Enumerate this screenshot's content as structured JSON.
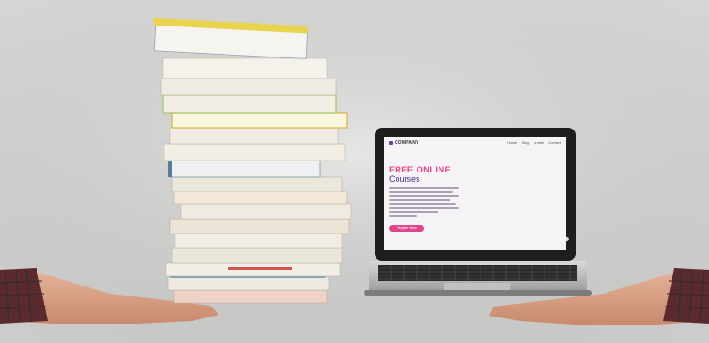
{
  "image": {
    "description_free": true
  },
  "laptop_site": {
    "brand": "COMPANY",
    "nav": [
      "Home",
      "Blog",
      "profile",
      "Contact"
    ],
    "headline": "FREE ONLINE",
    "subheadline": "Courses",
    "cta_label": "Register Now"
  },
  "colors": {
    "accent_pink": "#e0458b",
    "accent_purple": "#4b2d7f"
  }
}
